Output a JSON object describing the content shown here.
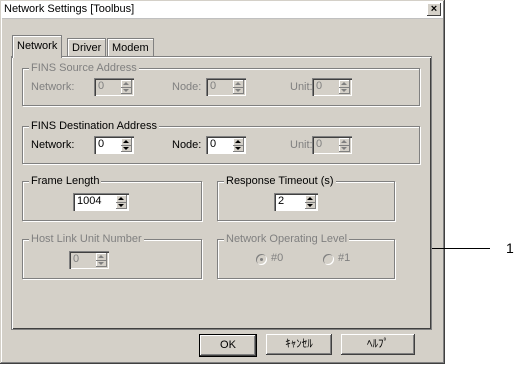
{
  "window": {
    "title": "Network Settings [Toolbus]",
    "close_label": "×"
  },
  "tabs": [
    {
      "label": "Network"
    },
    {
      "label": "Driver"
    },
    {
      "label": "Modem"
    }
  ],
  "fins_source": {
    "label": "FINS Source Address",
    "network_label": "Network:",
    "network_value": "0",
    "node_label": "Node:",
    "node_value": "0",
    "unit_label": "Unit:",
    "unit_value": "0"
  },
  "fins_dest": {
    "label": "FINS Destination Address",
    "network_label": "Network:",
    "network_value": "0",
    "node_label": "Node:",
    "node_value": "0",
    "unit_label": "Unit:",
    "unit_value": "0"
  },
  "frame_length": {
    "label": "Frame Length",
    "value": "1004"
  },
  "response_timeout": {
    "label": "Response Timeout (s)",
    "value": "2"
  },
  "host_link": {
    "label": "Host Link Unit Number",
    "value": "0"
  },
  "network_level": {
    "label": "Network Operating Level",
    "options": [
      {
        "label": "#0",
        "selected": true
      },
      {
        "label": "#1",
        "selected": false
      }
    ]
  },
  "buttons": {
    "ok": "OK",
    "cancel": "ｷｬﾝｾﾙ",
    "help": "ﾍﾙﾌﾟ"
  },
  "callout": {
    "number": "1"
  }
}
